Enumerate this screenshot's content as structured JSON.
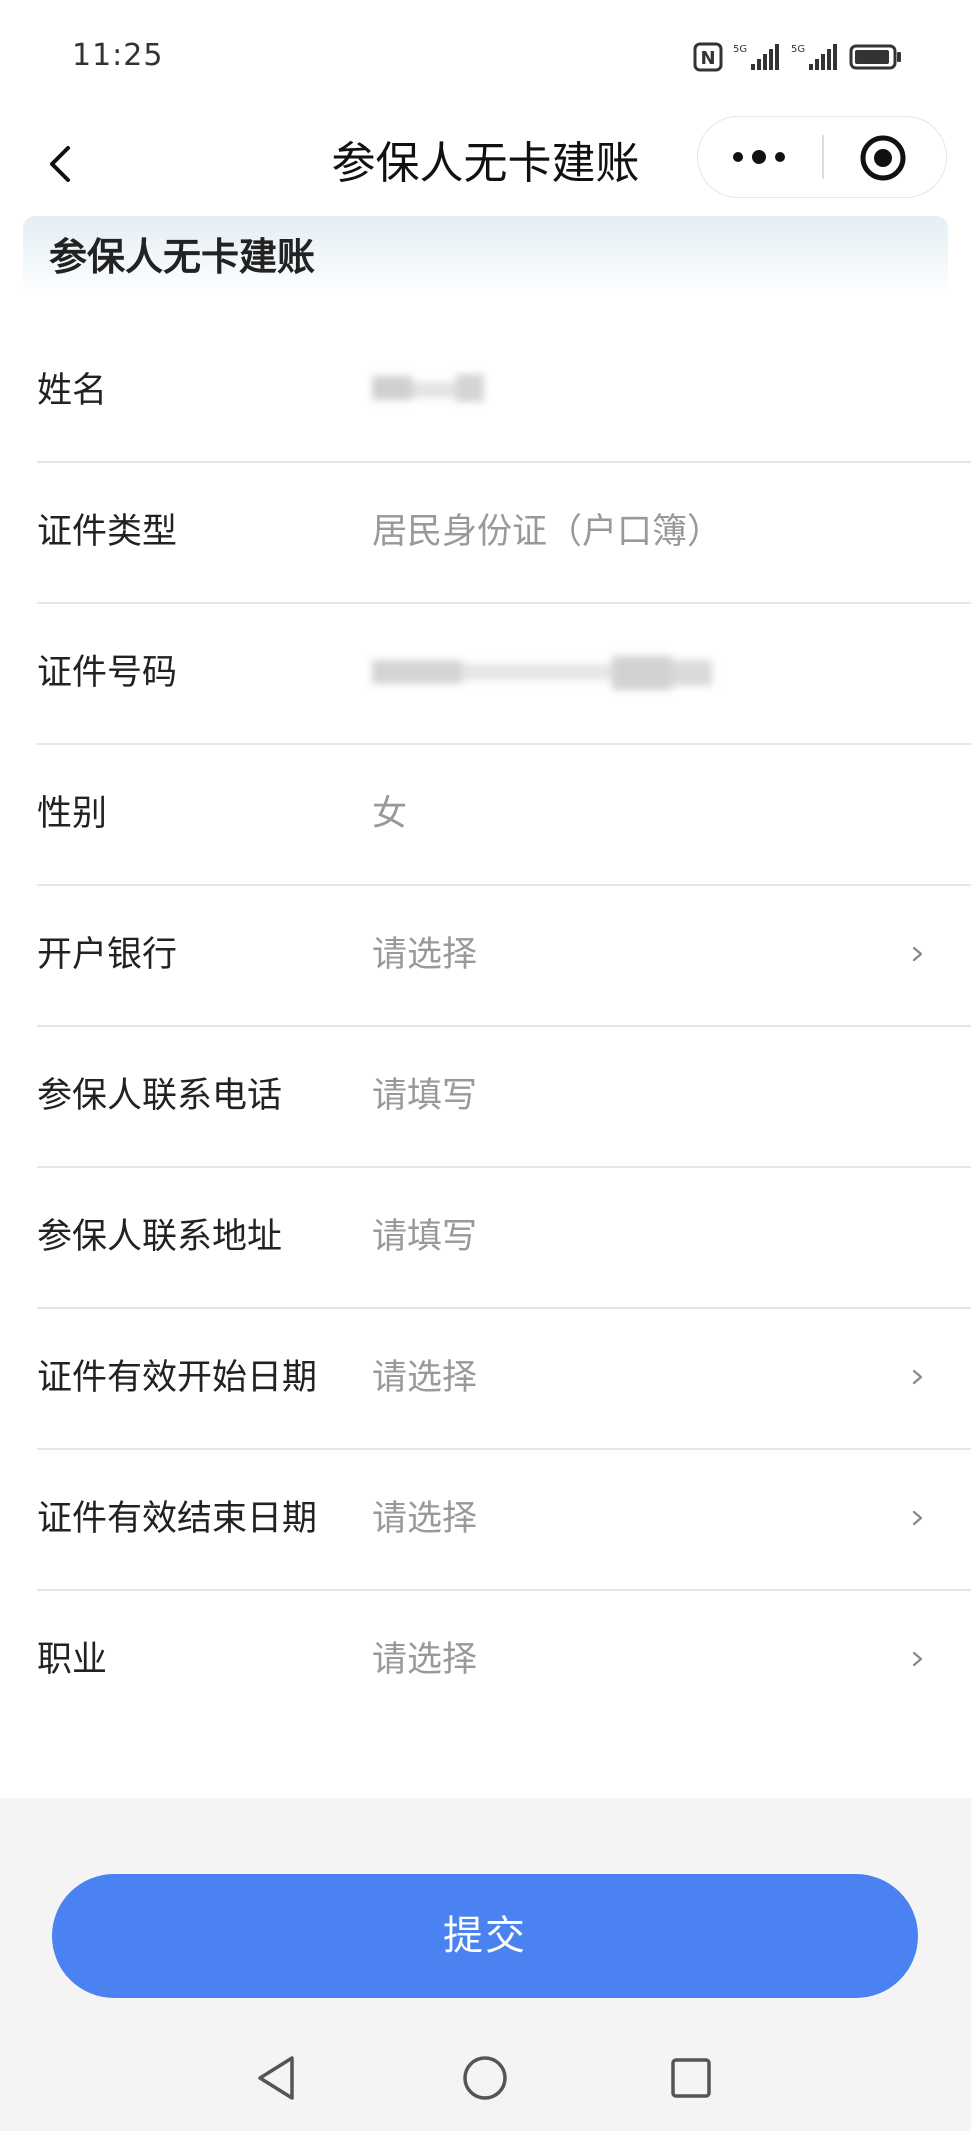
{
  "status_bar": {
    "time": "11:25",
    "nfc_label": "N",
    "sim1_label": "5G",
    "sim2_label": "5G"
  },
  "nav": {
    "title": "参保人无卡建账"
  },
  "section": {
    "title": "参保人无卡建账"
  },
  "form": {
    "rows": [
      {
        "label": "姓名",
        "value": "",
        "redacted": true
      },
      {
        "label": "证件类型",
        "value": "居民身份证（户口簿）"
      },
      {
        "label": "证件号码",
        "value": "",
        "redacted": true
      },
      {
        "label": "性别",
        "value": "女"
      },
      {
        "label": "开户银行",
        "value": "请选择",
        "chevron": true
      },
      {
        "label": "参保人联系电话",
        "value": "请填写"
      },
      {
        "label": "参保人联系地址",
        "value": "请填写"
      },
      {
        "label": "证件有效开始日期",
        "value": "请选择",
        "chevron": true
      },
      {
        "label": "证件有效结束日期",
        "value": "请选择",
        "chevron": true
      },
      {
        "label": "职业",
        "value": "请选择",
        "chevron": true
      }
    ]
  },
  "submit": {
    "label": "提交"
  },
  "colors": {
    "primary": "#4a82f1",
    "placeholder": "#999999",
    "label": "#222222",
    "divider": "#e6e6e6",
    "background": "#f4f4f5"
  }
}
